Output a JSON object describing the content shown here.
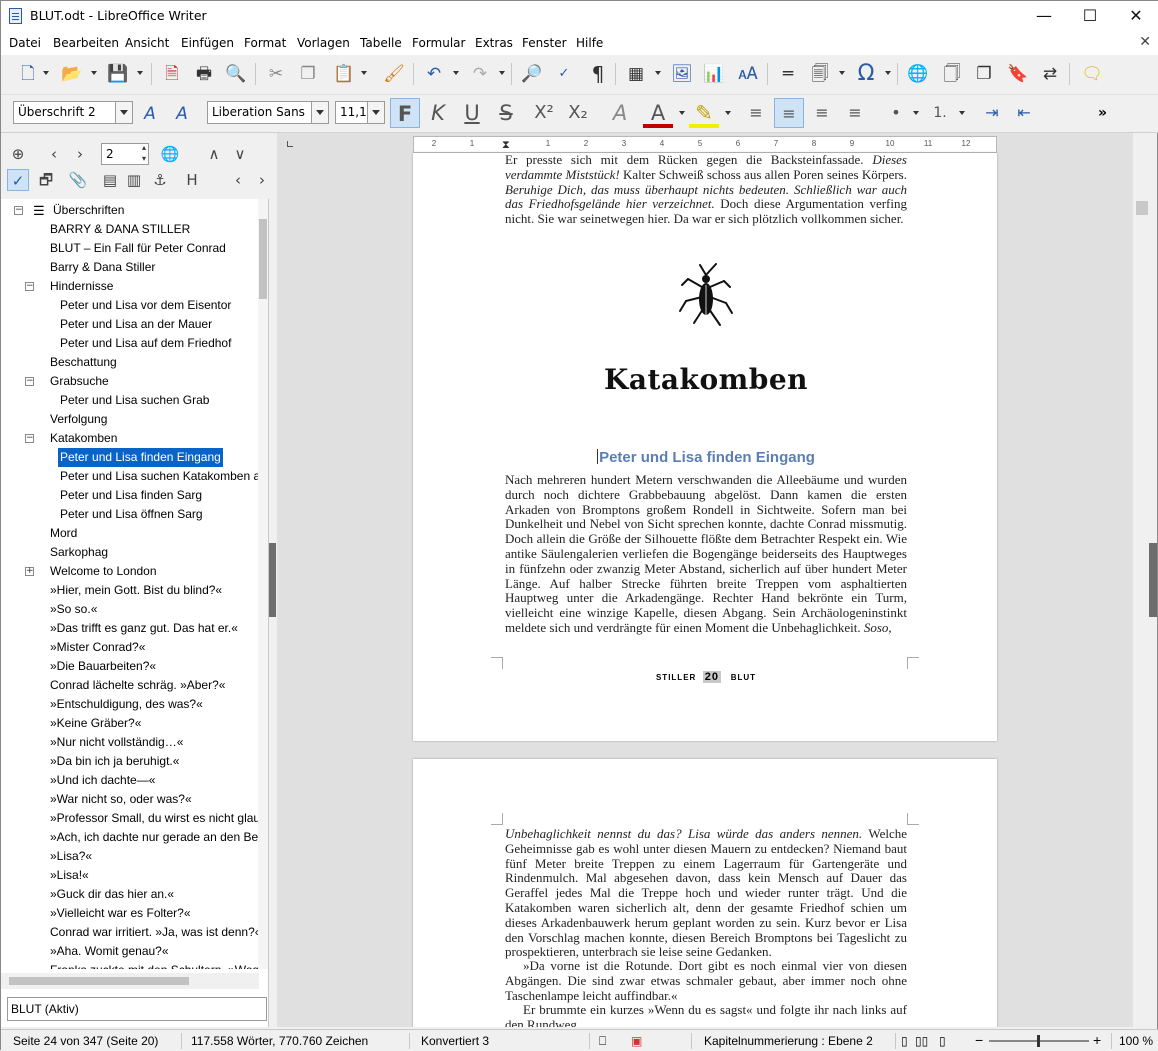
{
  "window": {
    "title": "BLUT.odt - LibreOffice Writer"
  },
  "menu": [
    "Datei",
    "Bearbeiten",
    "Ansicht",
    "Einfügen",
    "Format",
    "Vorlagen",
    "Tabelle",
    "Formular",
    "Extras",
    "Fenster",
    "Hilfe"
  ],
  "format_toolbar": {
    "paragraph_style": "Überschrift 2",
    "font_name": "Liberation Sans",
    "font_size": "11,1",
    "bold": "F",
    "italic": "K",
    "underline": "U",
    "strike": "S",
    "superscript": "X²",
    "subscript": "X₂"
  },
  "navigator": {
    "page_number": "2",
    "document": "BLUT (Aktiv)",
    "items": [
      {
        "label": "Überschriften",
        "level": 0,
        "expander": "minus"
      },
      {
        "label": "BARRY & DANA STILLER",
        "level": 1
      },
      {
        "label": "BLUT – Ein Fall für Peter Conrad",
        "level": 1
      },
      {
        "label": "Barry & Dana Stiller",
        "level": 1
      },
      {
        "label": "Hindernisse",
        "level": 1,
        "expander": "minus"
      },
      {
        "label": "Peter und Lisa vor dem Eisentor",
        "level": 2
      },
      {
        "label": "Peter und Lisa an der Mauer",
        "level": 2
      },
      {
        "label": "Peter und Lisa auf dem Friedhof",
        "level": 2
      },
      {
        "label": "Beschattung",
        "level": 1
      },
      {
        "label": "Grabsuche",
        "level": 1,
        "expander": "minus"
      },
      {
        "label": "Peter und Lisa suchen Grab",
        "level": 2
      },
      {
        "label": "Verfolgung",
        "level": 1
      },
      {
        "label": "Katakomben",
        "level": 1,
        "expander": "minus"
      },
      {
        "label": "Peter und Lisa finden Eingang",
        "level": 2,
        "selected": true
      },
      {
        "label": "Peter und Lisa suchen Katakomben ab",
        "level": 2
      },
      {
        "label": "Peter und Lisa finden Sarg",
        "level": 2
      },
      {
        "label": "Peter und Lisa öffnen Sarg",
        "level": 2
      },
      {
        "label": "Mord",
        "level": 1
      },
      {
        "label": "Sarkophag",
        "level": 1
      },
      {
        "label": "Welcome to London",
        "level": 1,
        "expander": "plus"
      },
      {
        "label": "»Hier, mein Gott. Bist du blind?«",
        "level": 1
      },
      {
        "label": "»So so.«",
        "level": 1
      },
      {
        "label": "»Das trifft es ganz gut. Das hat er.«",
        "level": 1
      },
      {
        "label": "»Mister Conrad?«",
        "level": 1
      },
      {
        "label": "»Die Bauarbeiten?«",
        "level": 1
      },
      {
        "label": "Conrad lächelte schräg. »Aber?«",
        "level": 1
      },
      {
        "label": "»Entschuldigung, des was?«",
        "level": 1
      },
      {
        "label": "»Keine Gräber?«",
        "level": 1
      },
      {
        "label": "»Nur nicht vollständig…«",
        "level": 1
      },
      {
        "label": "»Da bin ich ja beruhigt.«",
        "level": 1
      },
      {
        "label": "»Und ich dachte—«",
        "level": 1
      },
      {
        "label": "»War nicht so, oder was?«",
        "level": 1
      },
      {
        "label": "»Professor Small, du wirst es nicht glaub",
        "level": 1
      },
      {
        "label": "»Ach, ich dachte nur gerade an den Berg",
        "level": 1
      },
      {
        "label": "»Lisa?«",
        "level": 1
      },
      {
        "label": "»Lisa!«",
        "level": 1
      },
      {
        "label": "»Guck dir das hier an.«",
        "level": 1
      },
      {
        "label": "»Vielleicht war es Folter?«",
        "level": 1
      },
      {
        "label": "Conrad war irritiert. »Ja, was ist denn?«",
        "level": 1
      },
      {
        "label": "»Aha. Womit genau?«",
        "level": 1
      },
      {
        "label": "Franks zuckte mit den Schultern. »Weg.«",
        "level": 1
      }
    ]
  },
  "ruler": {
    "ticks": [
      "2",
      "1",
      "1",
      "2",
      "3",
      "4",
      "5",
      "6",
      "7",
      "8",
      "9",
      "10",
      "11",
      "12"
    ]
  },
  "document": {
    "page1_top_lines": [
      "Er presste sich mit dem Rücken gegen die Backsteinfassade. ",
      "verdammte Miststück! ",
      "Kalter Schweiß schoss aus allen Poren seines Körpers. ",
      "Beruhige Dich, das muss überhaupt nichts bedeuten. Schließlich war auch das Friedhofsgelände hier verzeichnet.",
      " Doch diese Argumentation verfing nicht. Sie war seinetwegen hier. Da war er sich plötzlich vollkommen sicher."
    ],
    "top_italic_a": "Dieses",
    "chapter_title": "Katakomben",
    "heading": "Peter und Lisa finden Eingang",
    "body1": "Nach mehreren hundert Metern verschwanden die Alleebäume und wurden durch noch dichtere Grabbebauung abgelöst. Dann kamen die ersten Arkaden von Bromptons großem Rondell in Sichtweite. Sofern man bei Dunkelheit und Nebel von Sicht sprechen konnte, dachte Conrad missmutig. Doch allein die Größe der Silhouette flößte dem Betrachter Respekt ein. Wie antike Säulengalerien verliefen die Bogengänge beiderseits des Hauptweges in fünfzehn oder zwanzig Meter Abstand, sicherlich auf über hundert Meter Länge. Auf halber Strecke führten breite Treppen vom asphaltierten Hauptweg unter die Arkadengänge. Rechter Hand bekrönte ein Turm, vielleicht eine winzige Kapelle, diesen Abgang. Sein Archäologeninstinkt meldete sich und verdrängte für einen Moment die Unbehaglichkeit. ",
    "body1_italic": "Soso,",
    "footer_left": "STILLER",
    "footer_page": "20",
    "footer_right": "BLUT",
    "page2_italic": "Unbehaglichkeit nennst du das? Lisa würde das anders nennen.",
    "page2_p1": " Welche Geheimnisse gab es wohl unter diesen Mauern zu entdecken? Niemand baut fünf Meter breite Treppen zu einem Lagerraum für Gartengeräte und Rindenmulch. Mal abgesehen davon, dass kein Mensch auf Dauer das Geraffel jedes Mal die Treppe hoch und wieder runter trägt. Und die Katakomben waren sicherlich alt, denn der gesamte Friedhof schien um dieses Arkadenbauwerk herum geplant worden zu sein. Kurz bevor er Lisa den Vorschlag machen konnte, diesen Bereich Bromptons bei Tageslicht zu prospektieren, unterbrach sie leise seine Gedanken.",
    "page2_p2": "»Da vorne ist die Rotunde. Dort gibt es noch einmal vier von diesen Abgängen. Die sind zwar etwas schmaler gebaut, aber immer noch ohne Taschenlampe leicht auffindbar.«",
    "page2_p3": "Er brummte ein kurzes »Wenn du es sagst« und folgte ihr nach links auf den Rundweg."
  },
  "status": {
    "page": "Seite 24 von 347 (Seite 20)",
    "words": "117.558 Wörter, 770.760 Zeichen",
    "converted": "Konvertiert 3",
    "outline": "Kapitelnummerierung : Ebene 2",
    "zoom": "100 %",
    "zoom_fraction": 0.5
  }
}
